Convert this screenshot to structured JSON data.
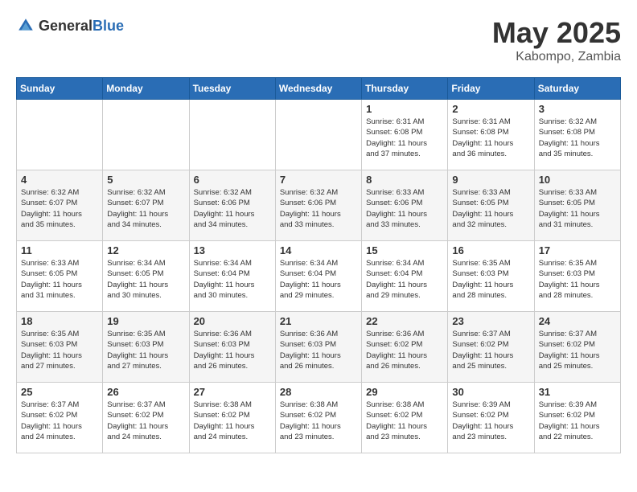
{
  "header": {
    "logo_general": "General",
    "logo_blue": "Blue",
    "month_year": "May 2025",
    "location": "Kabompo, Zambia"
  },
  "days_of_week": [
    "Sunday",
    "Monday",
    "Tuesday",
    "Wednesday",
    "Thursday",
    "Friday",
    "Saturday"
  ],
  "weeks": [
    [
      {
        "day": "",
        "info": ""
      },
      {
        "day": "",
        "info": ""
      },
      {
        "day": "",
        "info": ""
      },
      {
        "day": "",
        "info": ""
      },
      {
        "day": "1",
        "info": "Sunrise: 6:31 AM\nSunset: 6:08 PM\nDaylight: 11 hours\nand 37 minutes."
      },
      {
        "day": "2",
        "info": "Sunrise: 6:31 AM\nSunset: 6:08 PM\nDaylight: 11 hours\nand 36 minutes."
      },
      {
        "day": "3",
        "info": "Sunrise: 6:32 AM\nSunset: 6:08 PM\nDaylight: 11 hours\nand 35 minutes."
      }
    ],
    [
      {
        "day": "4",
        "info": "Sunrise: 6:32 AM\nSunset: 6:07 PM\nDaylight: 11 hours\nand 35 minutes."
      },
      {
        "day": "5",
        "info": "Sunrise: 6:32 AM\nSunset: 6:07 PM\nDaylight: 11 hours\nand 34 minutes."
      },
      {
        "day": "6",
        "info": "Sunrise: 6:32 AM\nSunset: 6:06 PM\nDaylight: 11 hours\nand 34 minutes."
      },
      {
        "day": "7",
        "info": "Sunrise: 6:32 AM\nSunset: 6:06 PM\nDaylight: 11 hours\nand 33 minutes."
      },
      {
        "day": "8",
        "info": "Sunrise: 6:33 AM\nSunset: 6:06 PM\nDaylight: 11 hours\nand 33 minutes."
      },
      {
        "day": "9",
        "info": "Sunrise: 6:33 AM\nSunset: 6:05 PM\nDaylight: 11 hours\nand 32 minutes."
      },
      {
        "day": "10",
        "info": "Sunrise: 6:33 AM\nSunset: 6:05 PM\nDaylight: 11 hours\nand 31 minutes."
      }
    ],
    [
      {
        "day": "11",
        "info": "Sunrise: 6:33 AM\nSunset: 6:05 PM\nDaylight: 11 hours\nand 31 minutes."
      },
      {
        "day": "12",
        "info": "Sunrise: 6:34 AM\nSunset: 6:05 PM\nDaylight: 11 hours\nand 30 minutes."
      },
      {
        "day": "13",
        "info": "Sunrise: 6:34 AM\nSunset: 6:04 PM\nDaylight: 11 hours\nand 30 minutes."
      },
      {
        "day": "14",
        "info": "Sunrise: 6:34 AM\nSunset: 6:04 PM\nDaylight: 11 hours\nand 29 minutes."
      },
      {
        "day": "15",
        "info": "Sunrise: 6:34 AM\nSunset: 6:04 PM\nDaylight: 11 hours\nand 29 minutes."
      },
      {
        "day": "16",
        "info": "Sunrise: 6:35 AM\nSunset: 6:03 PM\nDaylight: 11 hours\nand 28 minutes."
      },
      {
        "day": "17",
        "info": "Sunrise: 6:35 AM\nSunset: 6:03 PM\nDaylight: 11 hours\nand 28 minutes."
      }
    ],
    [
      {
        "day": "18",
        "info": "Sunrise: 6:35 AM\nSunset: 6:03 PM\nDaylight: 11 hours\nand 27 minutes."
      },
      {
        "day": "19",
        "info": "Sunrise: 6:35 AM\nSunset: 6:03 PM\nDaylight: 11 hours\nand 27 minutes."
      },
      {
        "day": "20",
        "info": "Sunrise: 6:36 AM\nSunset: 6:03 PM\nDaylight: 11 hours\nand 26 minutes."
      },
      {
        "day": "21",
        "info": "Sunrise: 6:36 AM\nSunset: 6:03 PM\nDaylight: 11 hours\nand 26 minutes."
      },
      {
        "day": "22",
        "info": "Sunrise: 6:36 AM\nSunset: 6:02 PM\nDaylight: 11 hours\nand 26 minutes."
      },
      {
        "day": "23",
        "info": "Sunrise: 6:37 AM\nSunset: 6:02 PM\nDaylight: 11 hours\nand 25 minutes."
      },
      {
        "day": "24",
        "info": "Sunrise: 6:37 AM\nSunset: 6:02 PM\nDaylight: 11 hours\nand 25 minutes."
      }
    ],
    [
      {
        "day": "25",
        "info": "Sunrise: 6:37 AM\nSunset: 6:02 PM\nDaylight: 11 hours\nand 24 minutes."
      },
      {
        "day": "26",
        "info": "Sunrise: 6:37 AM\nSunset: 6:02 PM\nDaylight: 11 hours\nand 24 minutes."
      },
      {
        "day": "27",
        "info": "Sunrise: 6:38 AM\nSunset: 6:02 PM\nDaylight: 11 hours\nand 24 minutes."
      },
      {
        "day": "28",
        "info": "Sunrise: 6:38 AM\nSunset: 6:02 PM\nDaylight: 11 hours\nand 23 minutes."
      },
      {
        "day": "29",
        "info": "Sunrise: 6:38 AM\nSunset: 6:02 PM\nDaylight: 11 hours\nand 23 minutes."
      },
      {
        "day": "30",
        "info": "Sunrise: 6:39 AM\nSunset: 6:02 PM\nDaylight: 11 hours\nand 23 minutes."
      },
      {
        "day": "31",
        "info": "Sunrise: 6:39 AM\nSunset: 6:02 PM\nDaylight: 11 hours\nand 22 minutes."
      }
    ]
  ]
}
